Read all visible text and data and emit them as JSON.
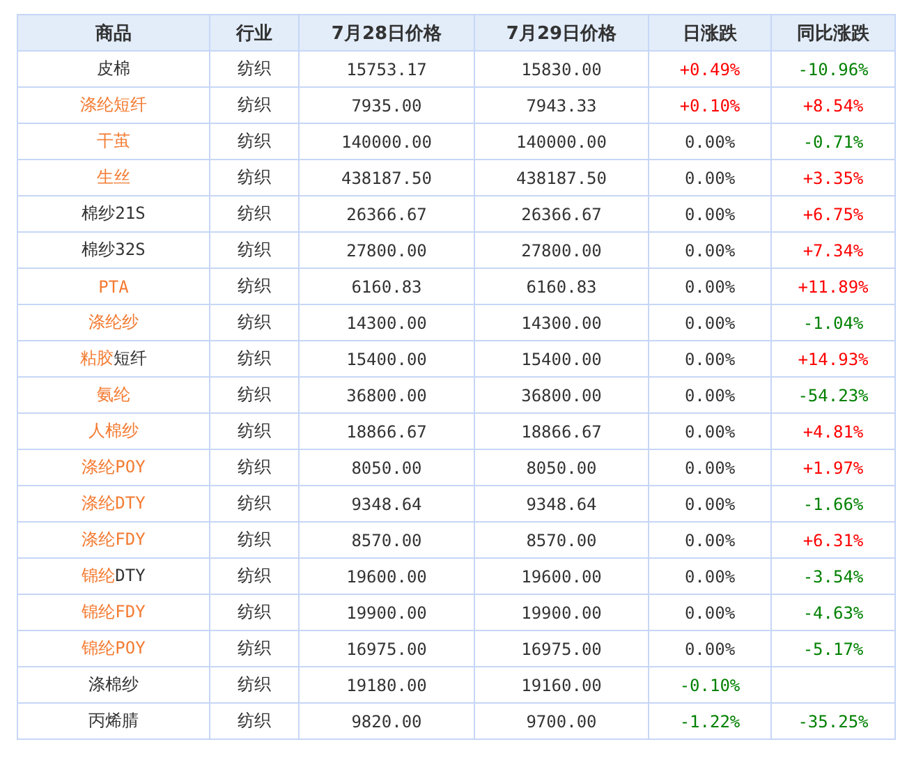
{
  "table": {
    "columns": [
      "商品",
      "行业",
      "7月28日价格",
      "7月29日价格",
      "日涨跌",
      "同比涨跌"
    ],
    "rows": [
      {
        "name": [
          {
            "text": "皮棉",
            "link": false
          }
        ],
        "industry": "纺织",
        "price_0728": "15753.17",
        "price_0729": "15830.00",
        "daily": {
          "text": "+0.49%",
          "color": "#ff0000"
        },
        "yoy": {
          "text": "-10.96%",
          "color": "#008000"
        }
      },
      {
        "name": [
          {
            "text": "涤纶短纤",
            "link": true
          }
        ],
        "industry": "纺织",
        "price_0728": "7935.00",
        "price_0729": "7943.33",
        "daily": {
          "text": "+0.10%",
          "color": "#ff0000"
        },
        "yoy": {
          "text": "+8.54%",
          "color": "#ff0000"
        }
      },
      {
        "name": [
          {
            "text": "干茧",
            "link": true
          }
        ],
        "industry": "纺织",
        "price_0728": "140000.00",
        "price_0729": "140000.00",
        "daily": {
          "text": "0.00%",
          "color": "#333333"
        },
        "yoy": {
          "text": "-0.71%",
          "color": "#008000"
        }
      },
      {
        "name": [
          {
            "text": "生丝",
            "link": true
          }
        ],
        "industry": "纺织",
        "price_0728": "438187.50",
        "price_0729": "438187.50",
        "daily": {
          "text": "0.00%",
          "color": "#333333"
        },
        "yoy": {
          "text": "+3.35%",
          "color": "#ff0000"
        }
      },
      {
        "name": [
          {
            "text": "棉纱21S",
            "link": false
          }
        ],
        "industry": "纺织",
        "price_0728": "26366.67",
        "price_0729": "26366.67",
        "daily": {
          "text": "0.00%",
          "color": "#333333"
        },
        "yoy": {
          "text": "+6.75%",
          "color": "#ff0000"
        }
      },
      {
        "name": [
          {
            "text": "棉纱32S",
            "link": false
          }
        ],
        "industry": "纺织",
        "price_0728": "27800.00",
        "price_0729": "27800.00",
        "daily": {
          "text": "0.00%",
          "color": "#333333"
        },
        "yoy": {
          "text": "+7.34%",
          "color": "#ff0000"
        }
      },
      {
        "name": [
          {
            "text": "PTA",
            "link": true
          }
        ],
        "industry": "纺织",
        "price_0728": "6160.83",
        "price_0729": "6160.83",
        "daily": {
          "text": "0.00%",
          "color": "#333333"
        },
        "yoy": {
          "text": "+11.89%",
          "color": "#ff0000"
        }
      },
      {
        "name": [
          {
            "text": "涤纶纱",
            "link": true
          }
        ],
        "industry": "纺织",
        "price_0728": "14300.00",
        "price_0729": "14300.00",
        "daily": {
          "text": "0.00%",
          "color": "#333333"
        },
        "yoy": {
          "text": "-1.04%",
          "color": "#008000"
        }
      },
      {
        "name": [
          {
            "text": "粘胶",
            "link": true
          },
          {
            "text": "短纤",
            "link": false
          }
        ],
        "industry": "纺织",
        "price_0728": "15400.00",
        "price_0729": "15400.00",
        "daily": {
          "text": "0.00%",
          "color": "#333333"
        },
        "yoy": {
          "text": "+14.93%",
          "color": "#ff0000"
        }
      },
      {
        "name": [
          {
            "text": "氨纶",
            "link": true
          }
        ],
        "industry": "纺织",
        "price_0728": "36800.00",
        "price_0729": "36800.00",
        "daily": {
          "text": "0.00%",
          "color": "#333333"
        },
        "yoy": {
          "text": "-54.23%",
          "color": "#008000"
        }
      },
      {
        "name": [
          {
            "text": "人棉纱",
            "link": true
          }
        ],
        "industry": "纺织",
        "price_0728": "18866.67",
        "price_0729": "18866.67",
        "daily": {
          "text": "0.00%",
          "color": "#333333"
        },
        "yoy": {
          "text": "+4.81%",
          "color": "#ff0000"
        }
      },
      {
        "name": [
          {
            "text": "涤纶POY",
            "link": true
          }
        ],
        "industry": "纺织",
        "price_0728": "8050.00",
        "price_0729": "8050.00",
        "daily": {
          "text": "0.00%",
          "color": "#333333"
        },
        "yoy": {
          "text": "+1.97%",
          "color": "#ff0000"
        }
      },
      {
        "name": [
          {
            "text": "涤纶DTY",
            "link": true
          }
        ],
        "industry": "纺织",
        "price_0728": "9348.64",
        "price_0729": "9348.64",
        "daily": {
          "text": "0.00%",
          "color": "#333333"
        },
        "yoy": {
          "text": "-1.66%",
          "color": "#008000"
        }
      },
      {
        "name": [
          {
            "text": "涤纶FDY",
            "link": true
          }
        ],
        "industry": "纺织",
        "price_0728": "8570.00",
        "price_0729": "8570.00",
        "daily": {
          "text": "0.00%",
          "color": "#333333"
        },
        "yoy": {
          "text": "+6.31%",
          "color": "#ff0000"
        }
      },
      {
        "name": [
          {
            "text": "锦纶",
            "link": true
          },
          {
            "text": "DTY",
            "link": false
          }
        ],
        "industry": "纺织",
        "price_0728": "19600.00",
        "price_0729": "19600.00",
        "daily": {
          "text": "0.00%",
          "color": "#333333"
        },
        "yoy": {
          "text": "-3.54%",
          "color": "#008000"
        }
      },
      {
        "name": [
          {
            "text": "锦纶FDY",
            "link": true
          }
        ],
        "industry": "纺织",
        "price_0728": "19900.00",
        "price_0729": "19900.00",
        "daily": {
          "text": "0.00%",
          "color": "#333333"
        },
        "yoy": {
          "text": "-4.63%",
          "color": "#008000"
        }
      },
      {
        "name": [
          {
            "text": "锦纶POY",
            "link": true
          }
        ],
        "industry": "纺织",
        "price_0728": "16975.00",
        "price_0729": "16975.00",
        "daily": {
          "text": "0.00%",
          "color": "#333333"
        },
        "yoy": {
          "text": "-5.17%",
          "color": "#008000"
        }
      },
      {
        "name": [
          {
            "text": "涤棉纱",
            "link": false
          }
        ],
        "industry": "纺织",
        "price_0728": "19180.00",
        "price_0729": "19160.00",
        "daily": {
          "text": "-0.10%",
          "color": "#008000"
        }
      },
      {
        "name": [
          {
            "text": "丙烯腈",
            "link": false
          }
        ],
        "industry": "纺织",
        "price_0728": "9820.00",
        "price_0729": "9700.00",
        "daily": {
          "text": "-1.22%",
          "color": "#008000"
        },
        "yoy": {
          "text": "-35.25%",
          "color": "#008000"
        }
      }
    ]
  }
}
